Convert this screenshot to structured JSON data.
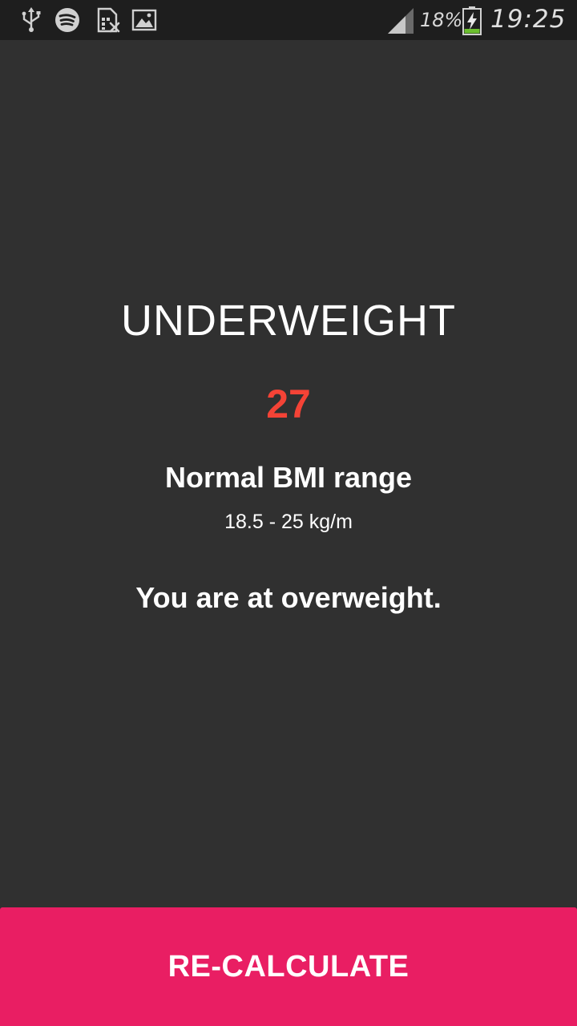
{
  "status_bar": {
    "icons": [
      "usb-icon",
      "spotify-icon",
      "sim-card-icon",
      "image-icon",
      "signal-icon",
      "battery-charging-icon"
    ],
    "battery_percent": "18%",
    "time": "19:25"
  },
  "result": {
    "category": "UNDERWEIGHT",
    "bmi_value": "27",
    "range_label": "Normal BMI range",
    "range_value": "18.5 - 25 kg/m",
    "message": "You are at overweight."
  },
  "actions": {
    "recalculate_label": "RE-CALCULATE"
  },
  "colors": {
    "background": "#303030",
    "status_bar": "#1e1e1e",
    "bmi_value": "#f44336",
    "button": "#e91e63",
    "text": "#ffffff"
  }
}
